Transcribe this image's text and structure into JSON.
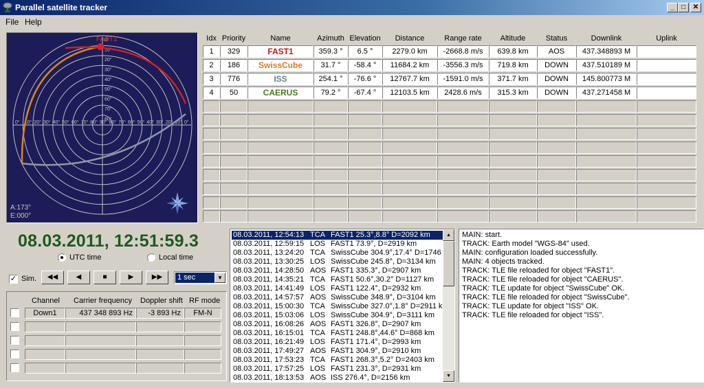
{
  "window": {
    "title": "Parallel satellite tracker",
    "controls": [
      "_",
      "□",
      "✕"
    ]
  },
  "menu": [
    "File",
    "Help"
  ],
  "radar": {
    "sat_label": "FAST1",
    "readout_az": "A:173°",
    "readout_el": "E:000°",
    "ring_labels": [
      "80°",
      "70°",
      "60°",
      "50°",
      "40°",
      "30°",
      "20°",
      "10°",
      "0°"
    ],
    "axis_labels": [
      "0°",
      "10°",
      "20°",
      "30°",
      "40°",
      "50°",
      "60°",
      "70°",
      "80°",
      "90°",
      "80°",
      "70°",
      "60°",
      "50°",
      "40°",
      "30°",
      "20°",
      "10°",
      "0°"
    ],
    "colors": {
      "background": "#1c1c58",
      "grid": "#c8c8c8",
      "fast1": "#cc2020",
      "swisscube": "#e08418",
      "iss": "#8c9aa4"
    }
  },
  "table": {
    "headers": [
      "Idx",
      "Priority",
      "Name",
      "Azimuth",
      "Elevation",
      "Distance",
      "Range rate",
      "Altitude",
      "Status",
      "Downlink",
      "Uplink"
    ],
    "rows": [
      {
        "idx": "1",
        "priority": "329",
        "name": "FAST1",
        "color": "#c41818",
        "azimuth": "359.3 °",
        "elevation": "6.5 °",
        "distance": "2279.0 km",
        "range_rate": "-2668.8 m/s",
        "altitude": "639.8 km",
        "status": "AOS",
        "downlink": "437.348893 M",
        "uplink": ""
      },
      {
        "idx": "2",
        "priority": "186",
        "name": "SwissCube",
        "color": "#e07818",
        "azimuth": "31.7 °",
        "elevation": "-58.4 °",
        "distance": "11684.2 km",
        "range_rate": "-3556.3 m/s",
        "altitude": "719.8 km",
        "status": "DOWN",
        "downlink": "437.510189 M",
        "uplink": ""
      },
      {
        "idx": "3",
        "priority": "776",
        "name": "ISS",
        "color": "#6c7c88",
        "azimuth": "254.1 °",
        "elevation": "-76.6 °",
        "distance": "12767.7 km",
        "range_rate": "-1591.0 m/s",
        "altitude": "371.7 km",
        "status": "DOWN",
        "downlink": "145.800773 M",
        "uplink": ""
      },
      {
        "idx": "4",
        "priority": "50",
        "name": "CAERUS",
        "color": "#4a7a1a",
        "azimuth": "79.2 °",
        "elevation": "-67.4 °",
        "distance": "12103.5 km",
        "range_rate": "2428.6 m/s",
        "altitude": "315.3 km",
        "status": "DOWN",
        "downlink": "437.271458 M",
        "uplink": ""
      }
    ]
  },
  "clock": {
    "datetime": "08.03.2011, 12:51:59.3",
    "utc_label": "UTC time",
    "local_label": "Local time",
    "utc_selected": true
  },
  "sim": {
    "label": "Sim.",
    "checked": true,
    "buttons": [
      "◀◀",
      "◀",
      "■",
      "▶",
      "▶▶"
    ],
    "speed": "1 sec"
  },
  "channels": {
    "headers": [
      "Channel",
      "Carrier frequency",
      "Doppler shift",
      "RF mode"
    ],
    "rows": [
      {
        "channel": "Down1",
        "carrier": "437 348 893 Hz",
        "doppler": "-3 893 Hz",
        "mode": "FM-N"
      },
      {
        "channel": "",
        "carrier": "",
        "doppler": "",
        "mode": ""
      },
      {
        "channel": "",
        "carrier": "",
        "doppler": "",
        "mode": ""
      },
      {
        "channel": "",
        "carrier": "",
        "doppler": "",
        "mode": ""
      },
      {
        "channel": "",
        "carrier": "",
        "doppler": "",
        "mode": ""
      }
    ]
  },
  "events": [
    {
      "time": "08.03.2011, 12:54:13",
      "type": "TCA",
      "detail": "FAST1  25.3°,8.8° D=2092 km"
    },
    {
      "time": "08.03.2011, 12:59:15",
      "type": "LOS",
      "detail": "FAST1  73.9°, D=2919 km"
    },
    {
      "time": "08.03.2011, 13:24:20",
      "type": "TCA",
      "detail": "SwissCube  304.9°,17.4° D=1746 k"
    },
    {
      "time": "08.03.2011, 13:30:25",
      "type": "LOS",
      "detail": "SwissCube  245.8°, D=3134 km"
    },
    {
      "time": "08.03.2011, 14:28:50",
      "type": "AOS",
      "detail": "FAST1  335.3°, D=2907 km"
    },
    {
      "time": "08.03.2011, 14:35:21",
      "type": "TCA",
      "detail": "FAST1  50.6°,30.2° D=1127 km"
    },
    {
      "time": "08.03.2011, 14:41:49",
      "type": "LOS",
      "detail": "FAST1  122.4°, D=2932 km"
    },
    {
      "time": "08.03.2011, 14:57:57",
      "type": "AOS",
      "detail": "SwissCube  348.9°, D=3104 km"
    },
    {
      "time": "08.03.2011, 15:00:30",
      "type": "TCA",
      "detail": "SwissCube  327.0°,1.8° D=2911 km"
    },
    {
      "time": "08.03.2011, 15:03:06",
      "type": "LOS",
      "detail": "SwissCube  304.9°, D=3111 km"
    },
    {
      "time": "08.03.2011, 16:08:26",
      "type": "AOS",
      "detail": "FAST1  326.8°, D=2907 km"
    },
    {
      "time": "08.03.2011, 16:15:01",
      "type": "TCA",
      "detail": "FAST1  248.8°,44.6° D=868 km"
    },
    {
      "time": "08.03.2011, 16:21:49",
      "type": "LOS",
      "detail": "FAST1  171.4°, D=2993 km"
    },
    {
      "time": "08.03.2011, 17:49:27",
      "type": "AOS",
      "detail": "FAST1  304.9°, D=2910 km"
    },
    {
      "time": "08.03.2011, 17:53:23",
      "type": "TCA",
      "detail": "FAST1  268.3°,5.2° D=2403 km"
    },
    {
      "time": "08.03.2011, 17:57:25",
      "type": "LOS",
      "detail": "FAST1  231.3°, D=2931 km"
    },
    {
      "time": "08.03.2011, 18:13:53",
      "type": "AOS",
      "detail": "ISS  276.4°, D=2156 km"
    }
  ],
  "log": [
    "MAIN: start.",
    "TRACK: Earth model \"WGS-84\" used.",
    "MAIN: configuration loaded successfully.",
    "MAIN: 4 objects tracked.",
    "TRACK: TLE file reloaded for object \"FAST1\".",
    "TRACK: TLE file reloaded for object \"CAERUS\".",
    "TRACK: TLE update for object \"SwissCube\" OK.",
    "TRACK: TLE file reloaded for object \"SwissCube\".",
    "TRACK: TLE update for object \"ISS\" OK.",
    "TRACK: TLE file reloaded for object \"ISS\"."
  ]
}
